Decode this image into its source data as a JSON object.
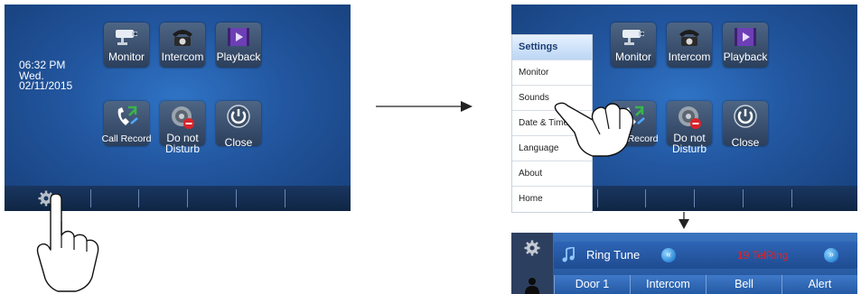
{
  "left_screen": {
    "time": "06:32 PM",
    "day": "Wed.",
    "date": "02/11/2015",
    "tiles": {
      "monitor": "Monitor",
      "intercom": "Intercom",
      "playback": "Playback",
      "call_record": "Call Record",
      "dnd_line1": "Do not",
      "dnd_line2": "Disturb",
      "close": "Close"
    }
  },
  "right_screen": {
    "tiles": {
      "monitor": "Monitor",
      "intercom": "Intercom",
      "playback": "Playback",
      "call_record": "Call Record",
      "dnd_line1": "Do not",
      "dnd_line2": "Disturb",
      "close": "Close"
    },
    "menu": {
      "title": "Settings",
      "items": [
        "Monitor",
        "Sounds",
        "Date & Time",
        "Language",
        "About",
        "Home"
      ]
    }
  },
  "ring_panel": {
    "label": "Ring Tune",
    "value": "19 TelRing",
    "prev_icon": "«",
    "next_icon": "»",
    "tabs": [
      "Door 1",
      "Intercom",
      "Bell",
      "Alert"
    ]
  },
  "colors": {
    "screen_blue": "#22569f",
    "menu_header": "#bcd6f4",
    "ring_value": "#e0242a"
  }
}
